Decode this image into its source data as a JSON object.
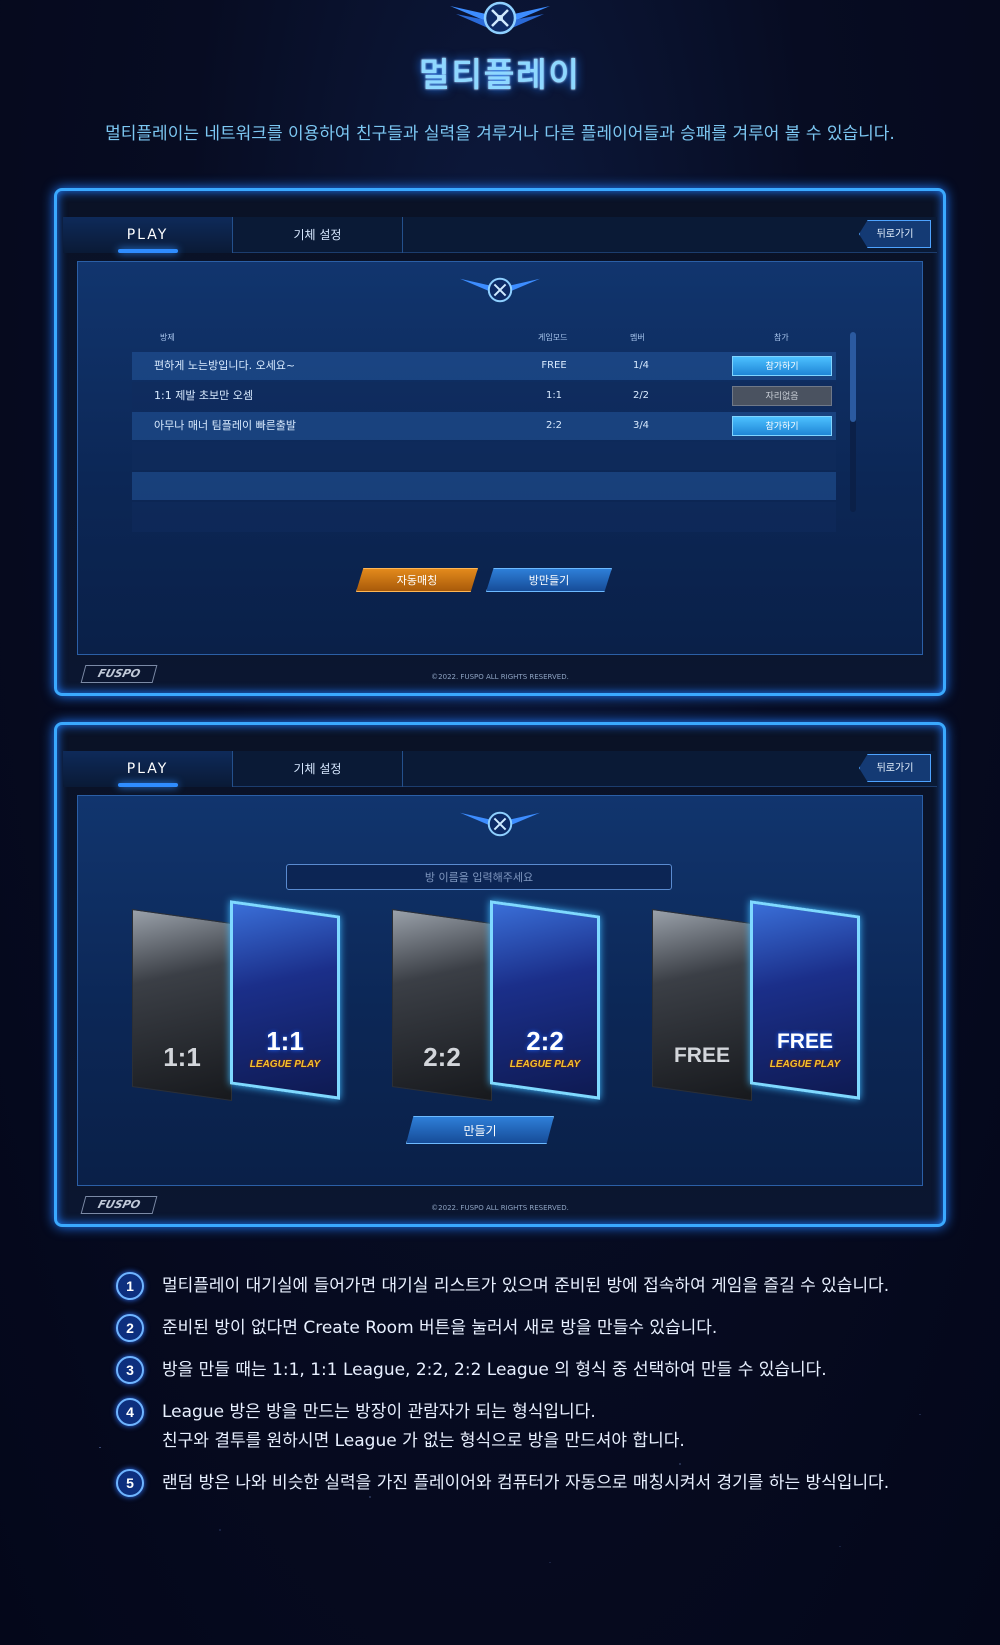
{
  "header": {
    "title": "멀티플레이",
    "description": "멀티플레이는 네트워크를 이용하여 친구들과 실력을 겨루거나 다른 플레이어들과 승패를 겨루어 볼 수 있습니다."
  },
  "ui": {
    "tab_play": "PLAY",
    "tab_setup": "기체 설정",
    "back_label": "뒤로가기",
    "footer_logo": "FUSPO",
    "copyright": "©2022. FUSPO ALL RIGHTS RESERVED."
  },
  "room_list": {
    "columns": {
      "title": "방제",
      "mode": "게임모드",
      "members": "멤버",
      "join": "참가"
    },
    "rows": [
      {
        "title": "편하게 노는방입니다. 오세요~",
        "mode": "FREE",
        "members": "1/4",
        "action": "참가하기"
      },
      {
        "title": "1:1 제발 초보만 오셈",
        "mode": "1:1",
        "members": "2/2",
        "action": "자리없음"
      },
      {
        "title": "아무나 매너 팀플레이 빠른출발",
        "mode": "2:2",
        "members": "3/4",
        "action": "참가하기"
      }
    ],
    "auto_match_label": "자동매칭",
    "create_room_label": "방만들기"
  },
  "create_room": {
    "name_placeholder": "방 이름을 입력해주세요",
    "modes": [
      {
        "label": "1:1",
        "league_label": "1:1",
        "league_sub": "LEAGUE PLAY"
      },
      {
        "label": "2:2",
        "league_label": "2:2",
        "league_sub": "LEAGUE PLAY"
      },
      {
        "label": "FREE",
        "league_label": "FREE",
        "league_sub": "LEAGUE PLAY"
      }
    ],
    "make_label": "만들기"
  },
  "steps": [
    {
      "num": "1",
      "text": "멀티플레이 대기실에 들어가면 대기실 리스트가 있으며 준비된 방에 접속하여 게임을 즐길 수 있습니다."
    },
    {
      "num": "2",
      "text": "준비된 방이 없다면 Create Room 버튼을 눌러서 새로 방을 만들수 있습니다."
    },
    {
      "num": "3",
      "text": "방을 만들 때는 1:1, 1:1 League, 2:2, 2:2 League 의 형식 중 선택하여 만들 수 있습니다."
    },
    {
      "num": "4",
      "text": "League 방은 방을 만드는 방장이 관람자가 되는 형식입니다.",
      "text2": "친구와 결투를 원하시면 League 가 없는 형식으로 방을 만드셔야 합니다."
    },
    {
      "num": "5",
      "text": "랜덤 방은 나와 비슷한 실력을 가진 플레이어와 컴퓨터가 자동으로 매칭시켜서 경기를 하는 방식입니다."
    }
  ]
}
